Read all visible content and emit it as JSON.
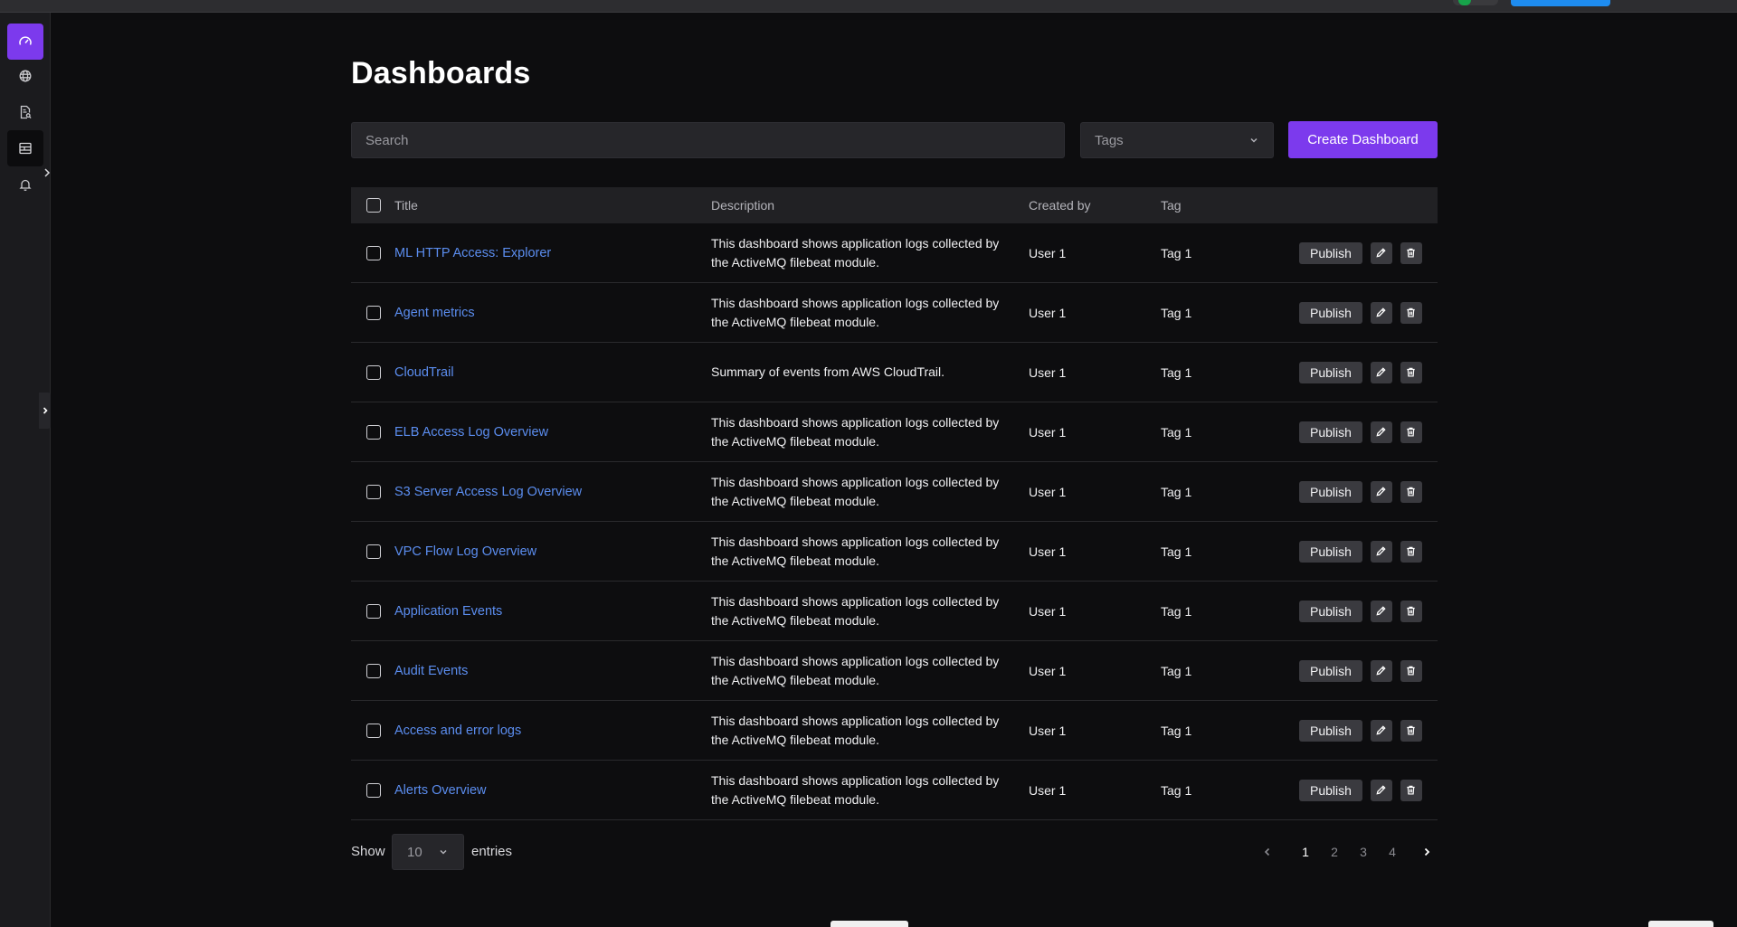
{
  "page": {
    "title": "Dashboards"
  },
  "search": {
    "placeholder": "Search"
  },
  "tags_filter": {
    "placeholder": "Tags"
  },
  "create_button": {
    "label": "Create Dashboard"
  },
  "sidebar": {
    "items": [
      {
        "icon": "gauge-icon",
        "active": true
      },
      {
        "icon": "globe-icon"
      },
      {
        "icon": "document-search-icon"
      },
      {
        "icon": "dashboard-icon",
        "selected": true
      },
      {
        "icon": "bell-icon"
      }
    ]
  },
  "table": {
    "columns": [
      "Title",
      "Description",
      "Created by",
      "Tag"
    ],
    "rows": [
      {
        "title": "ML HTTP Access: Explorer",
        "description": "This dashboard shows application logs collected by the ActiveMQ filebeat module.",
        "created_by": "User 1",
        "tag": "Tag 1",
        "action": "Publish"
      },
      {
        "title": "Agent metrics",
        "description": "This dashboard shows application logs collected by the ActiveMQ filebeat module.",
        "created_by": "User 1",
        "tag": "Tag 1",
        "action": "Publish"
      },
      {
        "title": "CloudTrail",
        "description": "Summary of events from AWS CloudTrail.",
        "created_by": "User 1",
        "tag": "Tag 1",
        "action": "Publish"
      },
      {
        "title": "ELB Access Log Overview",
        "description": "This dashboard shows application logs collected by the ActiveMQ filebeat module.",
        "created_by": "User 1",
        "tag": "Tag 1",
        "action": "Publish"
      },
      {
        "title": "S3 Server Access Log Overview",
        "description": "This dashboard shows application logs collected by the ActiveMQ filebeat module.",
        "created_by": "User 1",
        "tag": "Tag 1",
        "action": "Publish"
      },
      {
        "title": "VPC Flow Log Overview",
        "description": "This dashboard shows application logs collected by the ActiveMQ filebeat module.",
        "created_by": "User 1",
        "tag": "Tag 1",
        "action": "Publish"
      },
      {
        "title": "Application Events",
        "description": "This dashboard shows application logs collected by the ActiveMQ filebeat module.",
        "created_by": "User 1",
        "tag": "Tag 1",
        "action": "Publish"
      },
      {
        "title": "Audit Events",
        "description": "This dashboard shows application logs collected by the ActiveMQ filebeat module.",
        "created_by": "User 1",
        "tag": "Tag 1",
        "action": "Publish"
      },
      {
        "title": "Access and error logs",
        "description": "This dashboard shows application logs collected by the ActiveMQ filebeat module.",
        "created_by": "User 1",
        "tag": "Tag 1",
        "action": "Publish"
      },
      {
        "title": "Alerts Overview",
        "description": "This dashboard shows application logs collected by the ActiveMQ filebeat module.",
        "created_by": "User 1",
        "tag": "Tag 1",
        "action": "Publish"
      }
    ]
  },
  "pagination": {
    "show_label": "Show",
    "entries_value": "10",
    "entries_label": "entries",
    "pages": [
      "1",
      "2",
      "3",
      "4"
    ],
    "current_page": "1"
  },
  "colors": {
    "accent": "#7c3aed",
    "link": "#5b8def",
    "background": "#0d0d0f",
    "sidebar": "#1b1b1e"
  }
}
